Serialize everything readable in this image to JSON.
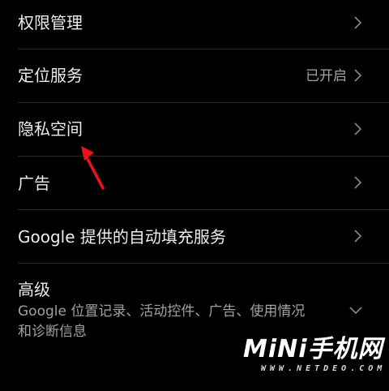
{
  "settings": {
    "items": [
      {
        "label": "权限管理",
        "value": ""
      },
      {
        "label": "定位服务",
        "value": "已开启"
      },
      {
        "label": "隐私空间",
        "value": ""
      },
      {
        "label": "广告",
        "value": ""
      },
      {
        "label": "Google 提供的自动填充服务",
        "value": ""
      }
    ],
    "advanced": {
      "label": "高级",
      "summary": "Google 位置记录、活动控件、广告、使用情况和诊断信息"
    }
  },
  "annotation": {
    "arrow_color": "#e8141c"
  },
  "watermark": {
    "main": "MiNi手机网",
    "sub": "WWW.NETDEO.COM"
  },
  "colors": {
    "background": "#000000",
    "primary_text": "#ececec",
    "secondary_text": "#a5a5a5",
    "divider": "#262626"
  }
}
